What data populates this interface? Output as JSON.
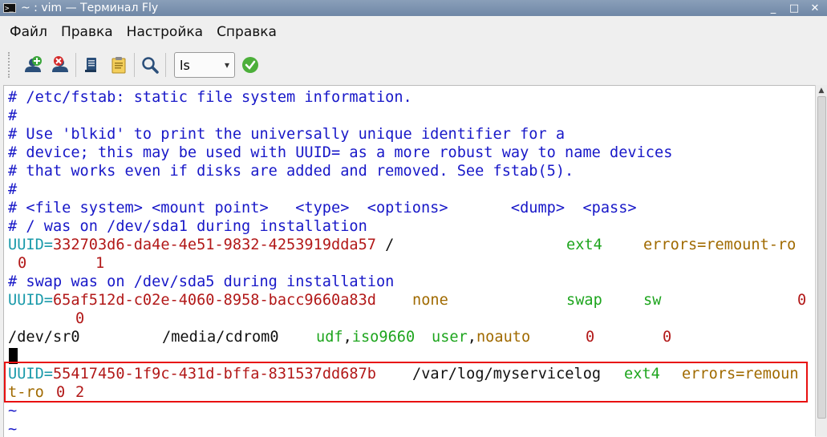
{
  "window": {
    "title": "~ : vim — Терминал Fly",
    "icon_text": ">_",
    "buttons": {
      "minimize": "_",
      "maximize": "□",
      "close": "✕"
    }
  },
  "menu": [
    "Файл",
    "Правка",
    "Настройка",
    "Справка"
  ],
  "toolbar": {
    "command_value": "ls",
    "command_arrow": "▾",
    "icons": [
      "new-tab-icon",
      "close-tab-icon",
      "copy-icon",
      "paste-icon",
      "search-icon",
      "execute-ok-icon"
    ]
  },
  "terminal": {
    "line1": "# /etc/fstab: static file system information.",
    "line2": "#",
    "line3": "# Use 'blkid' to print the universally unique identifier for a",
    "line4": "# device; this may be used with UUID= as a more robust way to name devices",
    "line5": "# that works even if disks are added and removed. See fstab(5).",
    "line6": "#",
    "line7": "# <file system> <mount point>   <type>  <options>       <dump>  <pass>",
    "line8": "# / was on /dev/sda1 during installation",
    "line9": {
      "key": "UUID",
      "eq": "=",
      "uuid": "332703d6-da4e-4e51-9832-4253919dda57",
      "mount": " /               ",
      "type": "ext4",
      "gap": "    ",
      "options": "errors=remount-ro"
    },
    "line10": {
      "dump": "0",
      "pass": "1"
    },
    "line11": "# swap was on /dev/sda5 during installation",
    "line12": {
      "key": "UUID",
      "eq": "=",
      "uuid": "65af512d-c02e-4060-8958-bacc9660a83d",
      "mount": "none",
      "type": "swap",
      "options": "sw",
      "dump": "0"
    },
    "line13": "0",
    "line14": {
      "device": "/dev/sr0",
      "mount": "/media/cdrom0",
      "type_a": "udf",
      "comma1": ",",
      "type_b": "iso9660",
      "opt_a": "user",
      "comma2": ",",
      "opt_b": "noauto",
      "dump": "0",
      "pass": "0"
    },
    "line16": {
      "key": "UUID",
      "eq": "=",
      "uuid": "55417450-1f9c-431d-bffa-831537dd687b",
      "mount": "/var/log/myservicelog",
      "type": "ext4",
      "options": "errors=remoun"
    },
    "line17": {
      "options": "t-ro",
      "dump": "0",
      "pass": "2"
    },
    "tilde": "~"
  },
  "colors": {
    "comment": "#1818c8",
    "key": "#1a9aaa",
    "value": "#b21818",
    "type": "#1ea51e",
    "option": "#a06a00",
    "highlight_border": "#e81010"
  }
}
